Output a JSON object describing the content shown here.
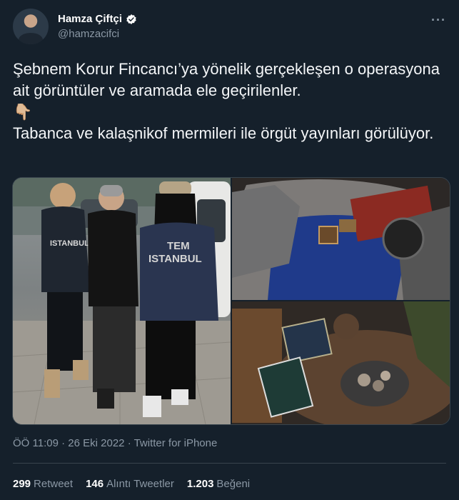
{
  "author": {
    "display_name": "Hamza Çiftçi",
    "handle": "@hamzacifci",
    "verified": true
  },
  "tweet": {
    "line1": "Şebnem Korur Fincancı’ya yönelik gerçekleşen o operasyona ait görüntüler ve aramada ele geçirilenler.",
    "emoji": "👇🏼",
    "line2": "Tabanca ve kalaşnikof mermileri ile örgüt yayınları görülüyor."
  },
  "media": {
    "photo_count": 3,
    "vest_text_1": "TEM",
    "vest_text_2": "ISTANBUL",
    "vest_text_left": "ISTANBUL"
  },
  "meta": {
    "time": "ÖÖ 11:09",
    "date": "26 Eki 2022",
    "source": "Twitter for iPhone"
  },
  "stats": {
    "retweets": "299",
    "retweets_label": "Retweet",
    "quotes": "146",
    "quotes_label": "Alıntı Tweetler",
    "likes": "1.203",
    "likes_label": "Beğeni"
  },
  "colors": {
    "background": "#15202b",
    "text_secondary": "#8b98a5",
    "verified": "#ffffff",
    "divider": "#38444d"
  }
}
